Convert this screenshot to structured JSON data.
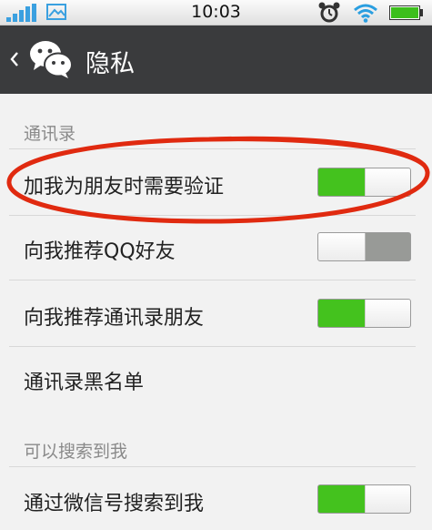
{
  "status_bar": {
    "time": "10:03",
    "icons": [
      "signal-icon",
      "image-icon",
      "alarm-icon",
      "wifi-icon",
      "battery-icon"
    ]
  },
  "header": {
    "back_icon": "chevron-left-icon",
    "logo_icon": "wechat-logo-icon",
    "title": "隐私"
  },
  "sections": [
    {
      "header": "通讯录",
      "rows": [
        {
          "label": "加我为朋友时需要验证",
          "toggle": "on"
        },
        {
          "label": "向我推荐QQ好友",
          "toggle": "off"
        },
        {
          "label": "向我推荐通讯录朋友",
          "toggle": "on"
        },
        {
          "label": "通讯录黑名单"
        }
      ]
    },
    {
      "header": "可以搜索到我",
      "rows": [
        {
          "label": "通过微信号搜索到我",
          "toggle": "on"
        }
      ]
    }
  ],
  "colors": {
    "titlebar": "#3a3b3d",
    "toggle_on": "#44c21e",
    "toggle_off": "#989a97",
    "annotation": "#e02a10"
  }
}
